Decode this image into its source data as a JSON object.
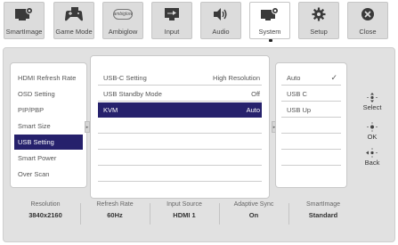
{
  "tabs": [
    {
      "label": "SmartImage",
      "icon": "smartimage-icon"
    },
    {
      "label": "Game Mode",
      "icon": "gamepad-icon"
    },
    {
      "label": "Ambiglow",
      "icon": "ambiglow-icon",
      "badge": "ambiglow"
    },
    {
      "label": "Input",
      "icon": "input-icon"
    },
    {
      "label": "Audio",
      "icon": "speaker-icon"
    },
    {
      "label": "System",
      "icon": "system-icon",
      "active": true
    },
    {
      "label": "Setup",
      "icon": "gear-icon"
    },
    {
      "label": "Close",
      "icon": "close-icon"
    }
  ],
  "menu": {
    "items": [
      "HDMI Refresh Rate",
      "OSD Setting",
      "PIP/PBP",
      "Smart Size",
      "USB Setting",
      "Smart Power",
      "Over Scan"
    ],
    "selected_index": 4
  },
  "submenu": {
    "rows": [
      {
        "label": "USB-C Setting",
        "value": "High Resolution"
      },
      {
        "label": "USB Standby Mode",
        "value": "Off"
      },
      {
        "label": "KVM",
        "value": "Auto",
        "selected": true
      },
      {
        "label": "",
        "value": ""
      },
      {
        "label": "",
        "value": ""
      },
      {
        "label": "",
        "value": ""
      },
      {
        "label": "",
        "value": ""
      }
    ]
  },
  "options": {
    "rows": [
      {
        "label": "Auto",
        "checked": true,
        "check_glyph": "✓"
      },
      {
        "label": "USB C"
      },
      {
        "label": "USB Up"
      },
      {
        "label": ""
      },
      {
        "label": ""
      },
      {
        "label": ""
      }
    ]
  },
  "controls": {
    "select_label": "Select",
    "ok_label": "OK",
    "back_label": "Back"
  },
  "status": [
    {
      "key": "Resolution",
      "value": "3840x2160"
    },
    {
      "key": "Refresh Rate",
      "value": "60Hz"
    },
    {
      "key": "Input Source",
      "value": "HDMI 1"
    },
    {
      "key": "Adaptive Sync",
      "value": "On"
    },
    {
      "key": "SmartImage",
      "value": "Standard"
    }
  ],
  "colors": {
    "selection": "#26216c",
    "panel": "#e1e1e1",
    "tab": "#dcdcdc"
  }
}
